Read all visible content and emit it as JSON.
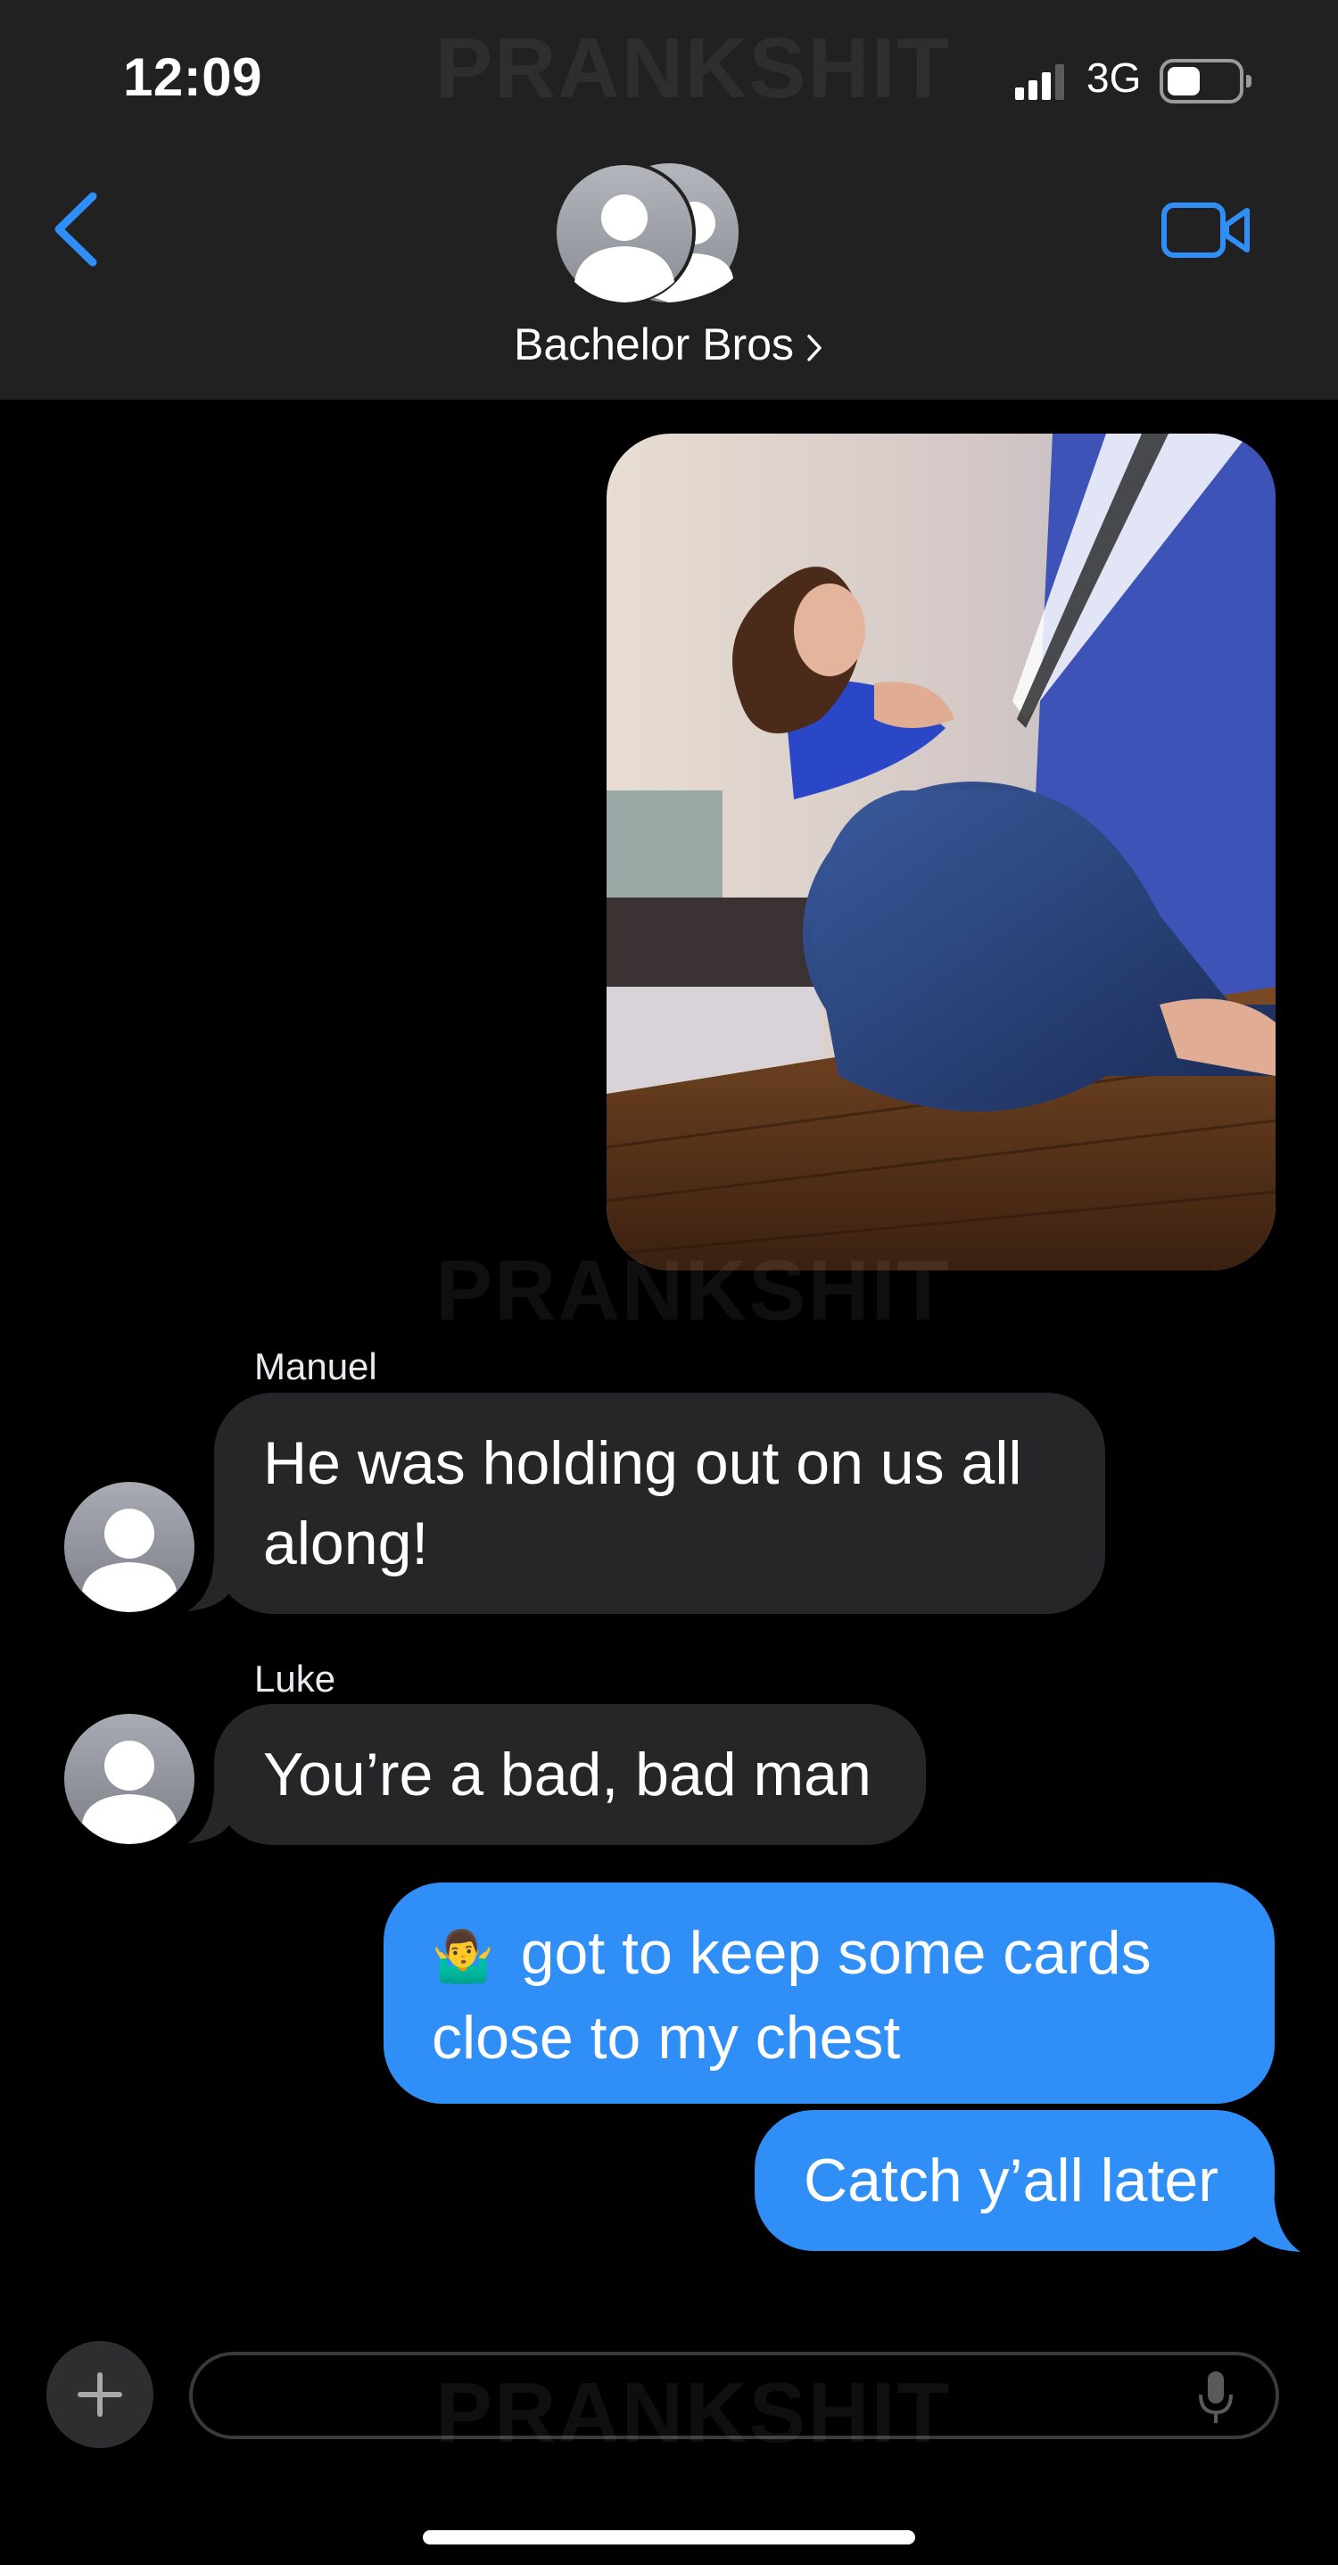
{
  "status_bar": {
    "time": "12:09",
    "network": "3G",
    "watermark": "PRANKSHIT"
  },
  "header": {
    "group_name": "Bachelor Bros",
    "back_icon": "chevron-left-icon",
    "video_icon": "video-camera-icon",
    "accent": "#2f8ff7"
  },
  "messages": [
    {
      "type": "image",
      "from": "me",
      "description_icon": "photo-attachment"
    },
    {
      "type": "text",
      "from": "Manuel",
      "sender_label": "Manuel",
      "lines": [
        "He was holding out on us all",
        "along!"
      ]
    },
    {
      "type": "text",
      "from": "Luke",
      "sender_label": "Luke",
      "lines": [
        "You’re a bad, bad man"
      ]
    },
    {
      "type": "text",
      "from": "me",
      "emoji": "🤷‍♂️",
      "lines": [
        "got to keep some cards",
        "close to my chest"
      ]
    },
    {
      "type": "text",
      "from": "me",
      "lines": [
        "Catch y’all later"
      ]
    }
  ],
  "watermarks": [
    "PRANKSHIT",
    "PRANKSHIT",
    "PRANKSHIT"
  ],
  "composer": {
    "plus_icon": "plus-icon",
    "mic_icon": "microphone-icon"
  },
  "colors": {
    "header_bg": "#212121",
    "incoming_bubble": "#262628",
    "outgoing_bubble": "#2f8ff7",
    "background": "#000000"
  }
}
